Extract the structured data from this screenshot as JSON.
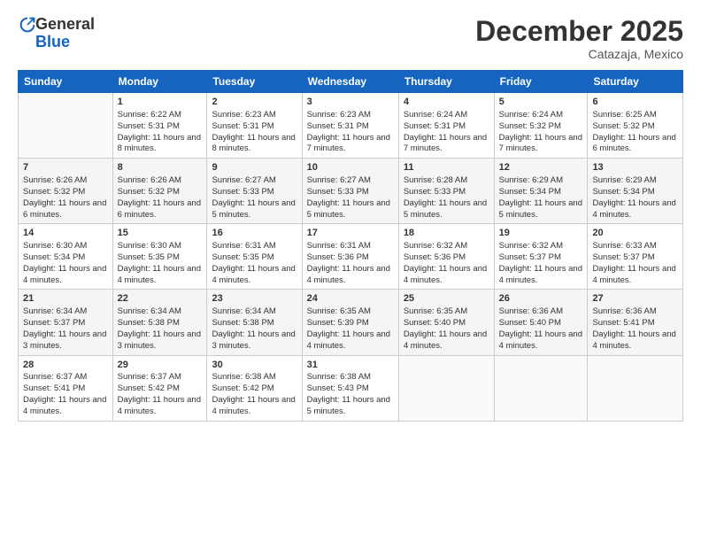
{
  "logo": {
    "general": "General",
    "blue": "Blue"
  },
  "header": {
    "month": "December 2025",
    "location": "Catazaja, Mexico"
  },
  "weekdays": [
    "Sunday",
    "Monday",
    "Tuesday",
    "Wednesday",
    "Thursday",
    "Friday",
    "Saturday"
  ],
  "weeks": [
    [
      {
        "day": "",
        "info": ""
      },
      {
        "day": "1",
        "sunrise": "6:22 AM",
        "sunset": "5:31 PM",
        "daylight": "11 hours and 8 minutes."
      },
      {
        "day": "2",
        "sunrise": "6:23 AM",
        "sunset": "5:31 PM",
        "daylight": "11 hours and 8 minutes."
      },
      {
        "day": "3",
        "sunrise": "6:23 AM",
        "sunset": "5:31 PM",
        "daylight": "11 hours and 7 minutes."
      },
      {
        "day": "4",
        "sunrise": "6:24 AM",
        "sunset": "5:31 PM",
        "daylight": "11 hours and 7 minutes."
      },
      {
        "day": "5",
        "sunrise": "6:24 AM",
        "sunset": "5:32 PM",
        "daylight": "11 hours and 7 minutes."
      },
      {
        "day": "6",
        "sunrise": "6:25 AM",
        "sunset": "5:32 PM",
        "daylight": "11 hours and 6 minutes."
      }
    ],
    [
      {
        "day": "7",
        "sunrise": "6:26 AM",
        "sunset": "5:32 PM",
        "daylight": "11 hours and 6 minutes."
      },
      {
        "day": "8",
        "sunrise": "6:26 AM",
        "sunset": "5:32 PM",
        "daylight": "11 hours and 6 minutes."
      },
      {
        "day": "9",
        "sunrise": "6:27 AM",
        "sunset": "5:33 PM",
        "daylight": "11 hours and 5 minutes."
      },
      {
        "day": "10",
        "sunrise": "6:27 AM",
        "sunset": "5:33 PM",
        "daylight": "11 hours and 5 minutes."
      },
      {
        "day": "11",
        "sunrise": "6:28 AM",
        "sunset": "5:33 PM",
        "daylight": "11 hours and 5 minutes."
      },
      {
        "day": "12",
        "sunrise": "6:29 AM",
        "sunset": "5:34 PM",
        "daylight": "11 hours and 5 minutes."
      },
      {
        "day": "13",
        "sunrise": "6:29 AM",
        "sunset": "5:34 PM",
        "daylight": "11 hours and 4 minutes."
      }
    ],
    [
      {
        "day": "14",
        "sunrise": "6:30 AM",
        "sunset": "5:34 PM",
        "daylight": "11 hours and 4 minutes."
      },
      {
        "day": "15",
        "sunrise": "6:30 AM",
        "sunset": "5:35 PM",
        "daylight": "11 hours and 4 minutes."
      },
      {
        "day": "16",
        "sunrise": "6:31 AM",
        "sunset": "5:35 PM",
        "daylight": "11 hours and 4 minutes."
      },
      {
        "day": "17",
        "sunrise": "6:31 AM",
        "sunset": "5:36 PM",
        "daylight": "11 hours and 4 minutes."
      },
      {
        "day": "18",
        "sunrise": "6:32 AM",
        "sunset": "5:36 PM",
        "daylight": "11 hours and 4 minutes."
      },
      {
        "day": "19",
        "sunrise": "6:32 AM",
        "sunset": "5:37 PM",
        "daylight": "11 hours and 4 minutes."
      },
      {
        "day": "20",
        "sunrise": "6:33 AM",
        "sunset": "5:37 PM",
        "daylight": "11 hours and 4 minutes."
      }
    ],
    [
      {
        "day": "21",
        "sunrise": "6:34 AM",
        "sunset": "5:37 PM",
        "daylight": "11 hours and 3 minutes."
      },
      {
        "day": "22",
        "sunrise": "6:34 AM",
        "sunset": "5:38 PM",
        "daylight": "11 hours and 3 minutes."
      },
      {
        "day": "23",
        "sunrise": "6:34 AM",
        "sunset": "5:38 PM",
        "daylight": "11 hours and 3 minutes."
      },
      {
        "day": "24",
        "sunrise": "6:35 AM",
        "sunset": "5:39 PM",
        "daylight": "11 hours and 4 minutes."
      },
      {
        "day": "25",
        "sunrise": "6:35 AM",
        "sunset": "5:40 PM",
        "daylight": "11 hours and 4 minutes."
      },
      {
        "day": "26",
        "sunrise": "6:36 AM",
        "sunset": "5:40 PM",
        "daylight": "11 hours and 4 minutes."
      },
      {
        "day": "27",
        "sunrise": "6:36 AM",
        "sunset": "5:41 PM",
        "daylight": "11 hours and 4 minutes."
      }
    ],
    [
      {
        "day": "28",
        "sunrise": "6:37 AM",
        "sunset": "5:41 PM",
        "daylight": "11 hours and 4 minutes."
      },
      {
        "day": "29",
        "sunrise": "6:37 AM",
        "sunset": "5:42 PM",
        "daylight": "11 hours and 4 minutes."
      },
      {
        "day": "30",
        "sunrise": "6:38 AM",
        "sunset": "5:42 PM",
        "daylight": "11 hours and 4 minutes."
      },
      {
        "day": "31",
        "sunrise": "6:38 AM",
        "sunset": "5:43 PM",
        "daylight": "11 hours and 5 minutes."
      },
      {
        "day": "",
        "info": ""
      },
      {
        "day": "",
        "info": ""
      },
      {
        "day": "",
        "info": ""
      }
    ]
  ]
}
